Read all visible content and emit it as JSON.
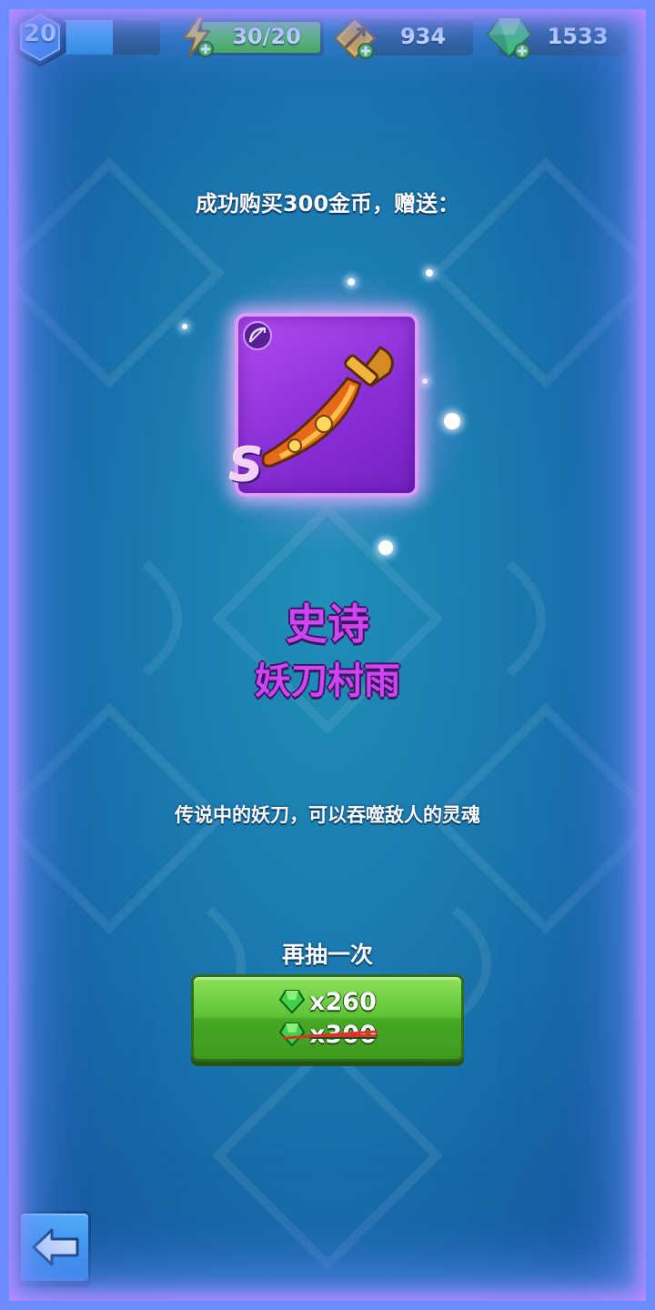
{
  "hud": {
    "level": "20",
    "xp_progress": 0.55,
    "energy": "30/20",
    "coins": "934",
    "gems": "1533"
  },
  "reward": {
    "message": "成功购买300金币，赠送：",
    "rank": "S",
    "rarity": "史诗",
    "name": "妖刀村雨",
    "description": "传说中的妖刀，可以吞噬敌人的灵魂"
  },
  "redraw": {
    "label": "再抽一次",
    "price": "x260",
    "original_price": "x300"
  },
  "colors": {
    "rarity_purple": "#cf45f2",
    "card_purple": "#8a2fd6",
    "button_green": "#5cc236",
    "back_blue": "#2c86e0"
  },
  "icons": {
    "level": "hexagon-badge-icon",
    "energy": "lightning-icon",
    "coins": "arrow-target-icon",
    "gems": "gem-icon",
    "class": "bow-icon",
    "weapon": "sword-icon",
    "back": "arrow-left-icon"
  }
}
